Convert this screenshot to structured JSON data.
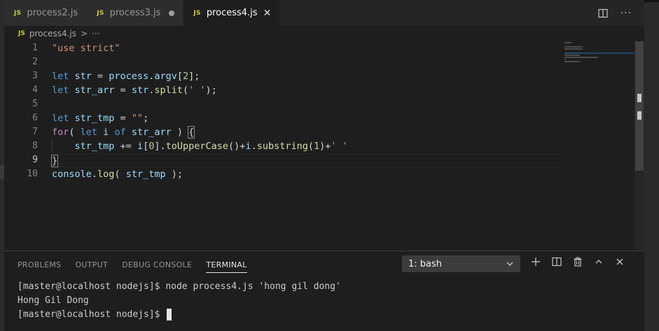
{
  "tabs": [
    {
      "label": "process2.js",
      "badge": "JS",
      "state": "normal"
    },
    {
      "label": "process3.js",
      "badge": "JS",
      "state": "dirty"
    },
    {
      "label": "process4.js",
      "badge": "JS",
      "state": "active"
    }
  ],
  "breadcrumb": {
    "badge": "JS",
    "file": "process4.js",
    "separator": ">",
    "more": "···"
  },
  "editor": {
    "current_line": 9,
    "line_numbers": [
      "1",
      "2",
      "3",
      "4",
      "5",
      "6",
      "7",
      "8",
      "9",
      "10"
    ],
    "lines": [
      [
        {
          "t": "\"use strict\"",
          "c": "str"
        }
      ],
      [],
      [
        {
          "t": "let ",
          "c": "kw"
        },
        {
          "t": "str",
          "c": "var"
        },
        {
          "t": " = ",
          "c": "punc"
        },
        {
          "t": "process",
          "c": "var"
        },
        {
          "t": ".",
          "c": "punc"
        },
        {
          "t": "argv",
          "c": "var"
        },
        {
          "t": "[",
          "c": "punc"
        },
        {
          "t": "2",
          "c": "num"
        },
        {
          "t": "];",
          "c": "punc"
        }
      ],
      [
        {
          "t": "let ",
          "c": "kw"
        },
        {
          "t": "str_arr",
          "c": "var"
        },
        {
          "t": " = ",
          "c": "punc"
        },
        {
          "t": "str",
          "c": "var"
        },
        {
          "t": ".",
          "c": "punc"
        },
        {
          "t": "split",
          "c": "fn"
        },
        {
          "t": "(",
          "c": "punc"
        },
        {
          "t": "' '",
          "c": "str"
        },
        {
          "t": ");",
          "c": "punc"
        }
      ],
      [],
      [
        {
          "t": "let ",
          "c": "kw"
        },
        {
          "t": "str_tmp",
          "c": "var"
        },
        {
          "t": " = ",
          "c": "punc"
        },
        {
          "t": "\"\"",
          "c": "str"
        },
        {
          "t": ";",
          "c": "punc"
        }
      ],
      [
        {
          "t": "for",
          "c": "ctrl"
        },
        {
          "t": "( ",
          "c": "punc"
        },
        {
          "t": "let ",
          "c": "kw"
        },
        {
          "t": "i",
          "c": "var"
        },
        {
          "t": " of ",
          "c": "kw"
        },
        {
          "t": "str_arr",
          "c": "var"
        },
        {
          "t": " ) ",
          "c": "punc"
        },
        {
          "t": "{",
          "c": "punc"
        }
      ],
      [
        {
          "t": "    ",
          "c": "punc"
        },
        {
          "t": "str_tmp",
          "c": "var"
        },
        {
          "t": " += ",
          "c": "punc"
        },
        {
          "t": "i",
          "c": "var"
        },
        {
          "t": "[",
          "c": "punc"
        },
        {
          "t": "0",
          "c": "num"
        },
        {
          "t": "].",
          "c": "punc"
        },
        {
          "t": "toUpperCase",
          "c": "fn"
        },
        {
          "t": "()+",
          "c": "punc"
        },
        {
          "t": "i",
          "c": "var"
        },
        {
          "t": ".",
          "c": "punc"
        },
        {
          "t": "substring",
          "c": "fn"
        },
        {
          "t": "(",
          "c": "punc"
        },
        {
          "t": "1",
          "c": "num"
        },
        {
          "t": ")+",
          "c": "punc"
        },
        {
          "t": "' '",
          "c": "str"
        }
      ],
      [
        {
          "t": "}",
          "c": "punc"
        }
      ],
      [
        {
          "t": "console",
          "c": "var"
        },
        {
          "t": ".",
          "c": "punc"
        },
        {
          "t": "log",
          "c": "fn"
        },
        {
          "t": "( ",
          "c": "punc"
        },
        {
          "t": "str_tmp",
          "c": "var"
        },
        {
          "t": " );",
          "c": "punc"
        }
      ]
    ]
  },
  "panel": {
    "tabs": [
      "PROBLEMS",
      "OUTPUT",
      "DEBUG CONSOLE",
      "TERMINAL"
    ],
    "active_tab": "TERMINAL",
    "terminal_select": "1: bash",
    "terminal_lines": [
      "[master@localhost nodejs]$ node process4.js 'hong gil dong'",
      "Hong Gil Dong",
      "[master@localhost nodejs]$ "
    ]
  },
  "colors": {
    "keyword": "#569cd6",
    "control": "#c586c0",
    "variable": "#9cdcfe",
    "function": "#dcdcaa",
    "string": "#ce9178",
    "number": "#b5cea8"
  }
}
